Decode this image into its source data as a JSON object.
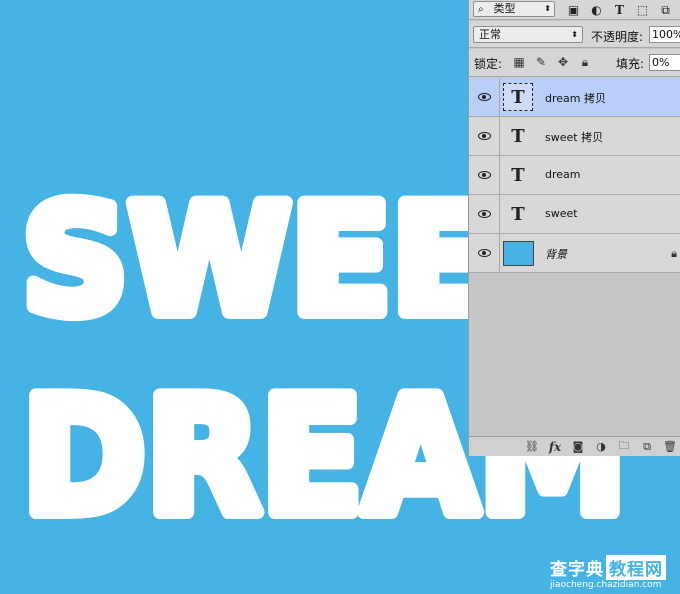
{
  "canvas": {
    "background": "#45b3e4",
    "text_color": "#ffffff",
    "line1": "SWEE",
    "line2": "DREAM"
  },
  "layers_panel": {
    "filter": {
      "kind_label": "类型",
      "icons": [
        "image-filter-icon",
        "adjustment-filter-icon",
        "type-filter-icon",
        "shape-filter-icon",
        "smart-object-filter-icon"
      ]
    },
    "blend_mode": "正常",
    "opacity_label": "不透明度:",
    "opacity_value": "100%",
    "lock_label": "锁定:",
    "fill_label": "填充:",
    "fill_value": "0%",
    "layers": [
      {
        "name": "dream 拷贝",
        "type": "text",
        "thumb": "T",
        "selected": true,
        "visible": true
      },
      {
        "name": "sweet 拷贝",
        "type": "text",
        "thumb": "T",
        "selected": false,
        "visible": true
      },
      {
        "name": "dream",
        "type": "text",
        "thumb": "T",
        "selected": false,
        "visible": true
      },
      {
        "name": "sweet",
        "type": "text",
        "thumb": "T",
        "selected": false,
        "visible": true
      },
      {
        "name": "背景",
        "type": "background",
        "thumb": "",
        "selected": false,
        "visible": true,
        "locked": true
      }
    ],
    "bottom_fx": "fx"
  },
  "watermark": {
    "main": "查字典",
    "boxed": "教程网",
    "url": "jiaocheng.chazidian.com"
  }
}
